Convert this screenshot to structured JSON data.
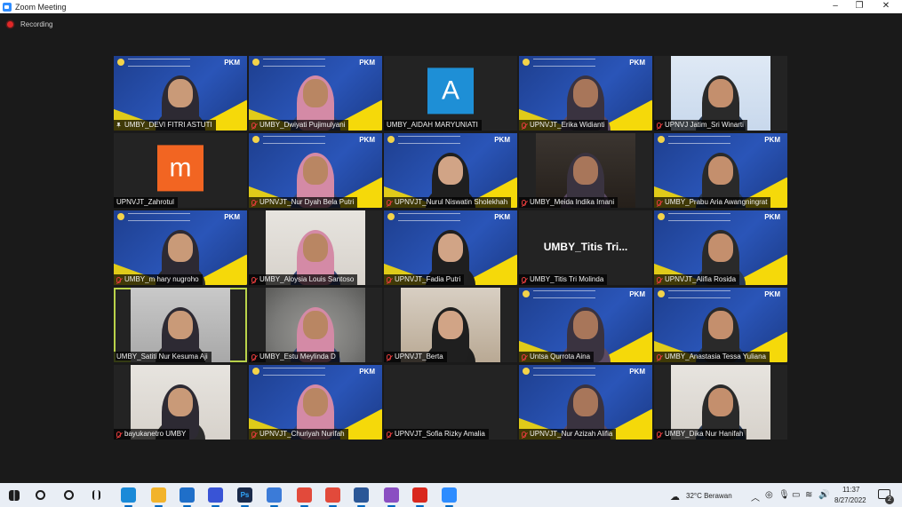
{
  "window": {
    "title": "Zoom Meeting",
    "minimize": "–",
    "maximize": "❐",
    "close": "✕"
  },
  "recording": {
    "label": "Recording",
    "icon": "recording-dot-icon"
  },
  "participants": [
    {
      "name": "UMBY_DEVI FITRI ASTUTI",
      "status": "pinned",
      "bg": "blue"
    },
    {
      "name": "UMBY_Dwiyati Pujimulyani",
      "status": "muted",
      "bg": "blue"
    },
    {
      "name": "UMBY_AIDAH MARYUNIATI",
      "status": "none",
      "avatar_letter": "A",
      "avatar_color": "#1e8fd6"
    },
    {
      "name": "UPNVJT_Erika Widianti",
      "status": "muted",
      "bg": "blue"
    },
    {
      "name": "UPNVJ Jatim_Sri Winarti",
      "status": "muted",
      "bg": "sky"
    },
    {
      "name": "UPNVJT_Zahrotul",
      "status": "none",
      "avatar_letter": "m",
      "avatar_color": "#f26522"
    },
    {
      "name": "UPNVJT_Nur Dyah Bela Putri",
      "status": "muted",
      "bg": "blue"
    },
    {
      "name": "UPNVJT_Nurul Niswatin Sholekhah",
      "status": "muted",
      "bg": "blue"
    },
    {
      "name": "UMBY_Meida Indika Irnani",
      "status": "muted",
      "bg": "dark"
    },
    {
      "name": "UMBY_Prabu Aria Awangningrat",
      "status": "muted",
      "bg": "blue"
    },
    {
      "name": "UMBY_m hary nugroho",
      "status": "muted",
      "bg": "blue"
    },
    {
      "name": "UMBY_Aloysia Louis Santoso",
      "status": "muted",
      "bg": "room"
    },
    {
      "name": "UPNVJT_Fadia Putri",
      "status": "muted",
      "bg": "blue"
    },
    {
      "name": "UMBY_Titis Tri Molinda",
      "status": "muted",
      "display_name": "UMBY_Titis Tri..."
    },
    {
      "name": "UPNVJT_Alifia Rosida",
      "status": "muted",
      "bg": "blue"
    },
    {
      "name": "UMBY_Satiti Nur Kesuma Aji",
      "status": "none",
      "bg": "grey",
      "active": true
    },
    {
      "name": "UMBY_Estu Meylinda D",
      "status": "muted",
      "bg": "blur"
    },
    {
      "name": "UPNVJT_Berta",
      "status": "muted",
      "bg": "warm"
    },
    {
      "name": "Untsa Qurrota Aina",
      "status": "muted",
      "bg": "blue"
    },
    {
      "name": "UMBY_Anastasia Tessa Yuliana",
      "status": "muted",
      "bg": "blue"
    },
    {
      "name": "bayukanetro UMBY",
      "status": "muted",
      "bg": "room"
    },
    {
      "name": "UPNVJT_Churiyah Nurifah",
      "status": "muted",
      "bg": "blue"
    },
    {
      "name": "UPNVJT_Sofia Rizky Amalia",
      "status": "muted",
      "bg": "none"
    },
    {
      "name": "UPNVJT_Nur Azizah Alifia",
      "status": "muted",
      "bg": "blue"
    },
    {
      "name": "UMBY_Dika Nur Hanifah",
      "status": "muted",
      "bg": "room"
    }
  ],
  "banner": {
    "pkm": "PKM"
  },
  "taskbar": {
    "icons": [
      "start-icon",
      "search-icon",
      "task-view-icon",
      "widgets-icon",
      "edge-icon",
      "explorer-icon",
      "mail-icon",
      "app-icon",
      "photoshop-icon",
      "browser-icon",
      "chrome-icon",
      "chrome-icon-2",
      "word-icon",
      "settings-icon",
      "acrobat-icon",
      "zoom-icon"
    ],
    "ps_label": "Ps",
    "weather": "32°C  Berawan",
    "time": "11:37",
    "date": "8/27/2022",
    "notifications": "2"
  }
}
